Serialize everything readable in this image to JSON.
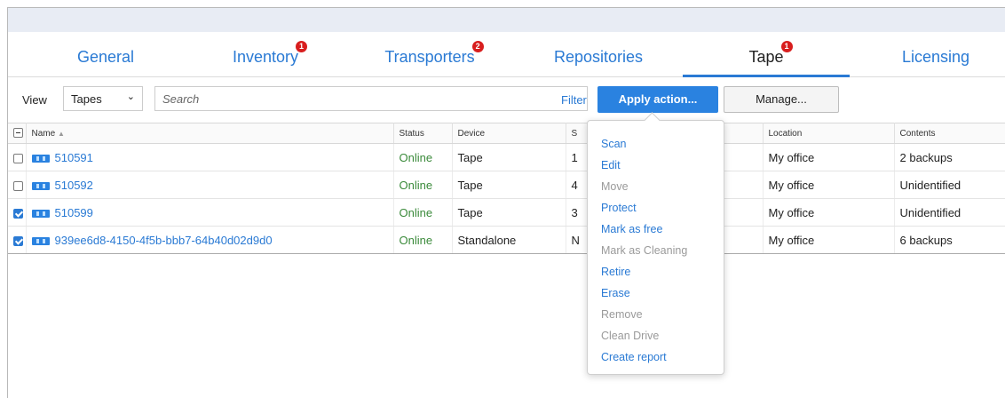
{
  "tabs": [
    {
      "label": "General",
      "badge": ""
    },
    {
      "label": "Inventory",
      "badge": "1"
    },
    {
      "label": "Transporters",
      "badge": "2"
    },
    {
      "label": "Repositories",
      "badge": ""
    },
    {
      "label": "Tape",
      "badge": "1"
    },
    {
      "label": "Licensing",
      "badge": ""
    }
  ],
  "toolbar": {
    "view_label": "View",
    "view_select": "Tapes",
    "search_placeholder": "Search",
    "filter_label": "Filter",
    "apply_label": "Apply action...",
    "manage_label": "Manage..."
  },
  "table": {
    "headers": {
      "name": "Name",
      "status": "Status",
      "device": "Device",
      "s": "S",
      "location": "Location",
      "contents": "Contents"
    },
    "rows": [
      {
        "checked": false,
        "name": "510591",
        "status": "Online",
        "device": "Tape",
        "s": "1",
        "location": "My office",
        "contents": "2 backups"
      },
      {
        "checked": false,
        "name": "510592",
        "status": "Online",
        "device": "Tape",
        "s": "4",
        "location": "My office",
        "contents": "Unidentified"
      },
      {
        "checked": true,
        "name": "510599",
        "status": "Online",
        "device": "Tape",
        "s": "3",
        "location": "My office",
        "contents": "Unidentified"
      },
      {
        "checked": true,
        "name": "939ee6d8-4150-4f5b-bbb7-64b40d02d9d0",
        "status": "Online",
        "device": "Standalone",
        "s": "N",
        "location": "My office",
        "contents": "6 backups"
      }
    ]
  },
  "menu": {
    "items": [
      {
        "label": "Scan",
        "enabled": true
      },
      {
        "label": "Edit",
        "enabled": true
      },
      {
        "label": "Move",
        "enabled": false
      },
      {
        "label": "Protect",
        "enabled": true
      },
      {
        "label": "Mark as free",
        "enabled": true
      },
      {
        "label": "Mark as Cleaning",
        "enabled": false
      },
      {
        "label": "Retire",
        "enabled": true
      },
      {
        "label": "Erase",
        "enabled": true
      },
      {
        "label": "Remove",
        "enabled": false
      },
      {
        "label": "Clean Drive",
        "enabled": false
      },
      {
        "label": "Create report",
        "enabled": true
      }
    ]
  },
  "colors": {
    "accent": "#2a7ad4",
    "button": "#2a82e0",
    "badge": "#d81e1e",
    "online": "#3a8a3a"
  }
}
